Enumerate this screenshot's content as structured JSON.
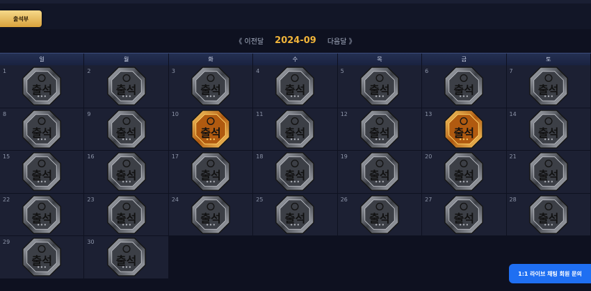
{
  "tab": {
    "label": "출석부"
  },
  "month_nav": {
    "prev_label": "《 이전달",
    "current": "2024-09",
    "next_label": "다음달 》"
  },
  "weekdays": [
    "일",
    "월",
    "화",
    "수",
    "목",
    "금",
    "토"
  ],
  "stamp": {
    "label": "출석",
    "gold_days": [
      10,
      13
    ],
    "colors": {
      "silver_light": "#b9bcc3",
      "silver_dark": "#3c3f46",
      "gold_light": "#ffd36a",
      "gold_dark": "#b05a10"
    }
  },
  "days": [
    {
      "n": "1"
    },
    {
      "n": "2"
    },
    {
      "n": "3"
    },
    {
      "n": "4"
    },
    {
      "n": "5"
    },
    {
      "n": "6"
    },
    {
      "n": "7"
    },
    {
      "n": "8"
    },
    {
      "n": "9"
    },
    {
      "n": "10"
    },
    {
      "n": "11"
    },
    {
      "n": "12"
    },
    {
      "n": "13"
    },
    {
      "n": "14"
    },
    {
      "n": "15"
    },
    {
      "n": "16"
    },
    {
      "n": "17"
    },
    {
      "n": "18"
    },
    {
      "n": "19"
    },
    {
      "n": "20"
    },
    {
      "n": "21"
    },
    {
      "n": "22"
    },
    {
      "n": "23"
    },
    {
      "n": "24"
    },
    {
      "n": "25"
    },
    {
      "n": "26"
    },
    {
      "n": "27"
    },
    {
      "n": "28"
    },
    {
      "n": "29"
    },
    {
      "n": "30"
    }
  ],
  "live_chat": {
    "label": "1:1 라이브 채팅 회원 문의"
  }
}
